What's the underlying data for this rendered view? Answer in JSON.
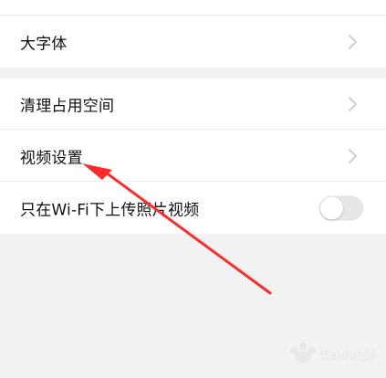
{
  "settings": {
    "font_size_label": "大字体",
    "clear_storage_label": "清理占用空间",
    "video_settings_label": "视频设置",
    "wifi_only_label": "只在Wi-Fi下上传照片视频",
    "wifi_only_enabled": false
  },
  "icons": {
    "chevron": "chevron-right-icon",
    "toggle": "toggle-switch-icon"
  },
  "colors": {
    "background": "#f2f2f2",
    "card": "#ffffff",
    "text": "#111111",
    "chevron": "#c7c7c7",
    "toggle_off": "#e7e7e7",
    "annotation_arrow": "#ff2a2a"
  },
  "watermark": {
    "text": "Baidu经验"
  }
}
